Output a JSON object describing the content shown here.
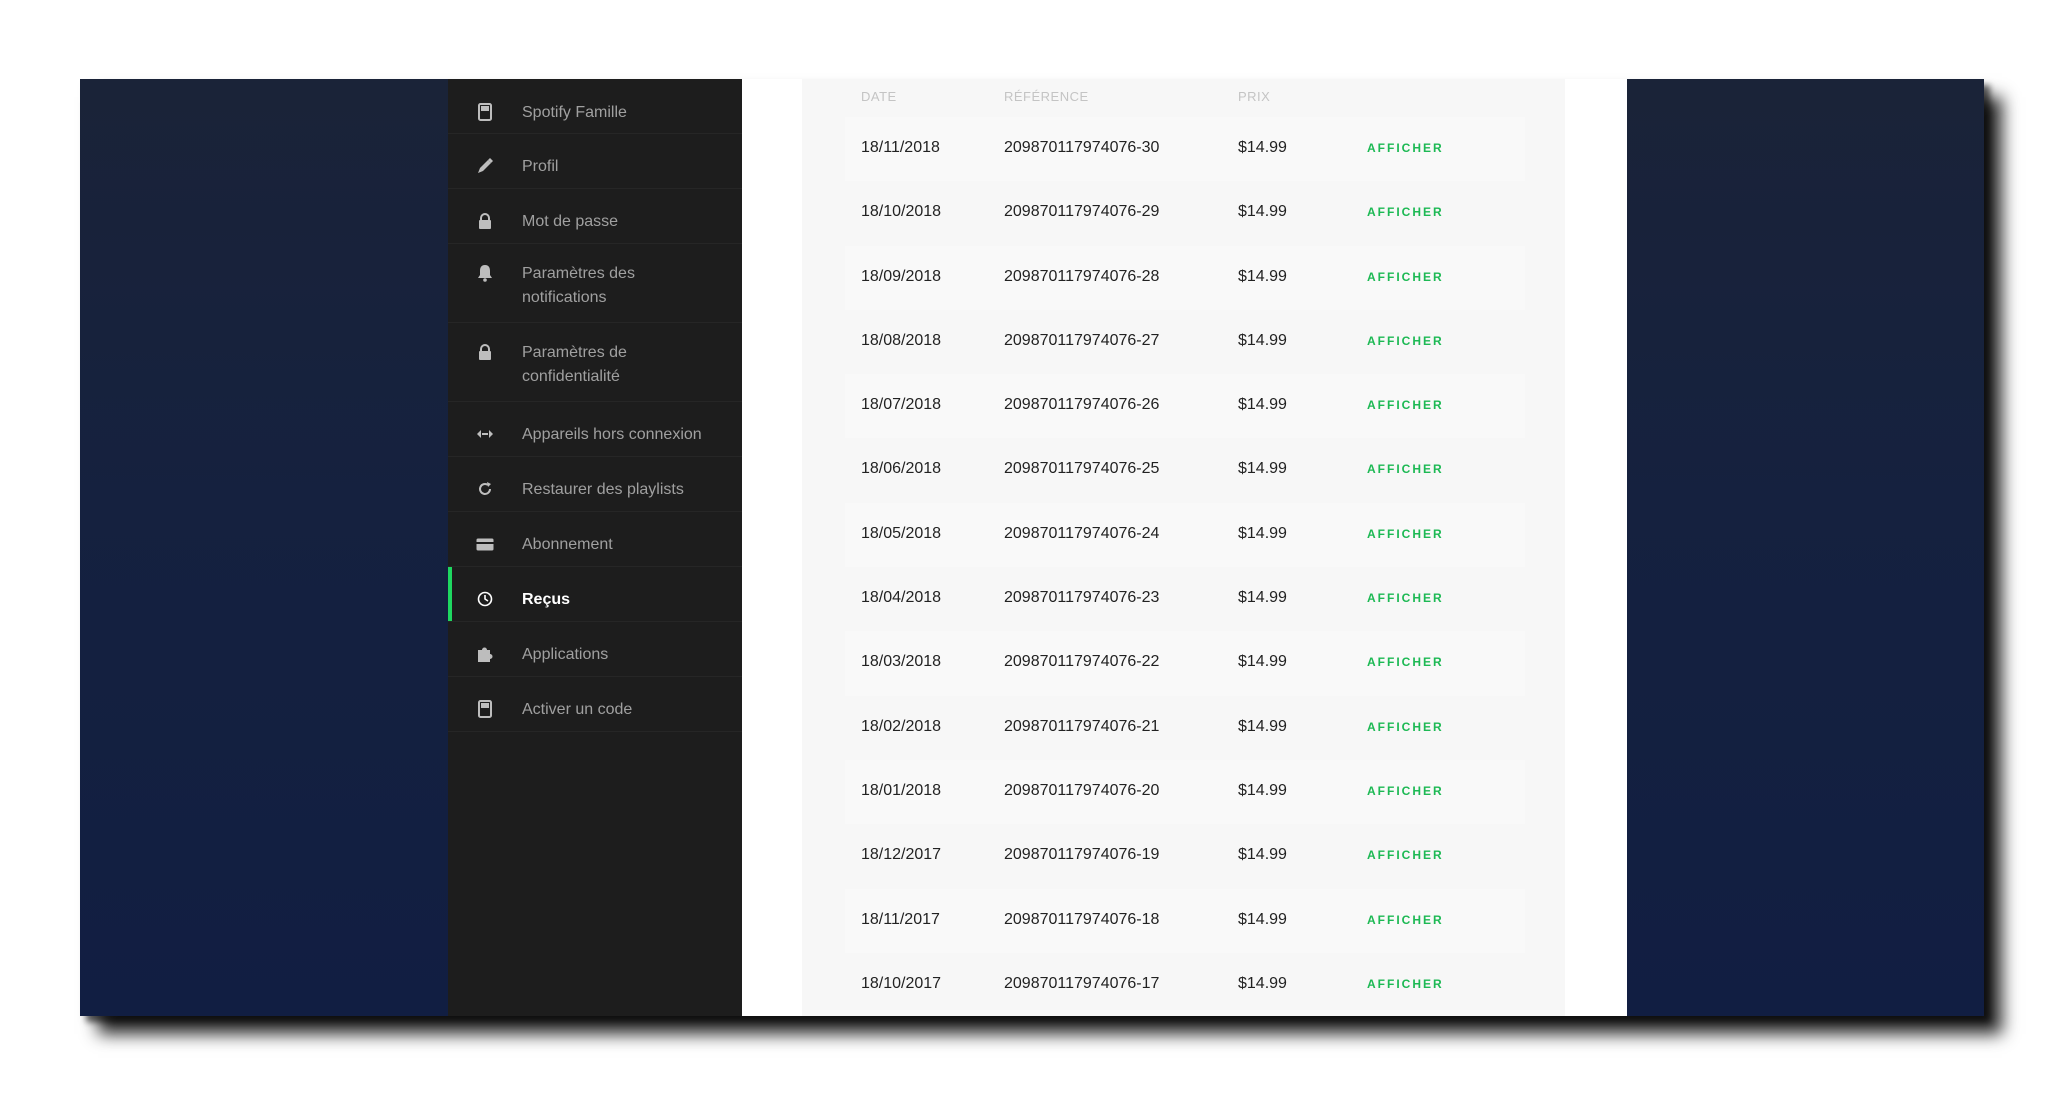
{
  "sidebar": {
    "items": [
      {
        "label": "Spotify Famille",
        "icon": "family-card-icon",
        "active": false
      },
      {
        "label": "Profil",
        "icon": "pencil-icon",
        "active": false
      },
      {
        "label": "Mot de passe",
        "icon": "lock-icon",
        "active": false
      },
      {
        "label": "Paramètres des notifications",
        "icon": "bell-icon",
        "active": false
      },
      {
        "label": "Paramètres de confidentialité",
        "icon": "lock-icon",
        "active": false
      },
      {
        "label": "Appareils hors connexion",
        "icon": "devices-icon",
        "active": false
      },
      {
        "label": "Restaurer des playlists",
        "icon": "refresh-icon",
        "active": false
      },
      {
        "label": "Abonnement",
        "icon": "credit-card-icon",
        "active": false
      },
      {
        "label": "Reçus",
        "icon": "clock-icon",
        "active": true
      },
      {
        "label": "Applications",
        "icon": "puzzle-icon",
        "active": false
      },
      {
        "label": "Activer un code",
        "icon": "gift-card-icon",
        "active": false
      }
    ]
  },
  "receipts": {
    "headers": {
      "date": "DATE",
      "reference": "RÉFÉRENCE",
      "price": "PRIX"
    },
    "action_label": "AFFICHER",
    "rows": [
      {
        "date": "18/11/2018",
        "reference": "209870117974076-30",
        "price": "$14.99"
      },
      {
        "date": "18/10/2018",
        "reference": "209870117974076-29",
        "price": "$14.99"
      },
      {
        "date": "18/09/2018",
        "reference": "209870117974076-28",
        "price": "$14.99"
      },
      {
        "date": "18/08/2018",
        "reference": "209870117974076-27",
        "price": "$14.99"
      },
      {
        "date": "18/07/2018",
        "reference": "209870117974076-26",
        "price": "$14.99"
      },
      {
        "date": "18/06/2018",
        "reference": "209870117974076-25",
        "price": "$14.99"
      },
      {
        "date": "18/05/2018",
        "reference": "209870117974076-24",
        "price": "$14.99"
      },
      {
        "date": "18/04/2018",
        "reference": "209870117974076-23",
        "price": "$14.99"
      },
      {
        "date": "18/03/2018",
        "reference": "209870117974076-22",
        "price": "$14.99"
      },
      {
        "date": "18/02/2018",
        "reference": "209870117974076-21",
        "price": "$14.99"
      },
      {
        "date": "18/01/2018",
        "reference": "209870117974076-20",
        "price": "$14.99"
      },
      {
        "date": "18/12/2017",
        "reference": "209870117974076-19",
        "price": "$14.99"
      },
      {
        "date": "18/11/2017",
        "reference": "209870117974076-18",
        "price": "$14.99"
      },
      {
        "date": "18/10/2017",
        "reference": "209870117974076-17",
        "price": "$14.99"
      }
    ]
  },
  "colors": {
    "accent": "#1ed760",
    "action": "#1db954",
    "sidebar_bg": "#1d1d1d",
    "backdrop": "#142042"
  }
}
